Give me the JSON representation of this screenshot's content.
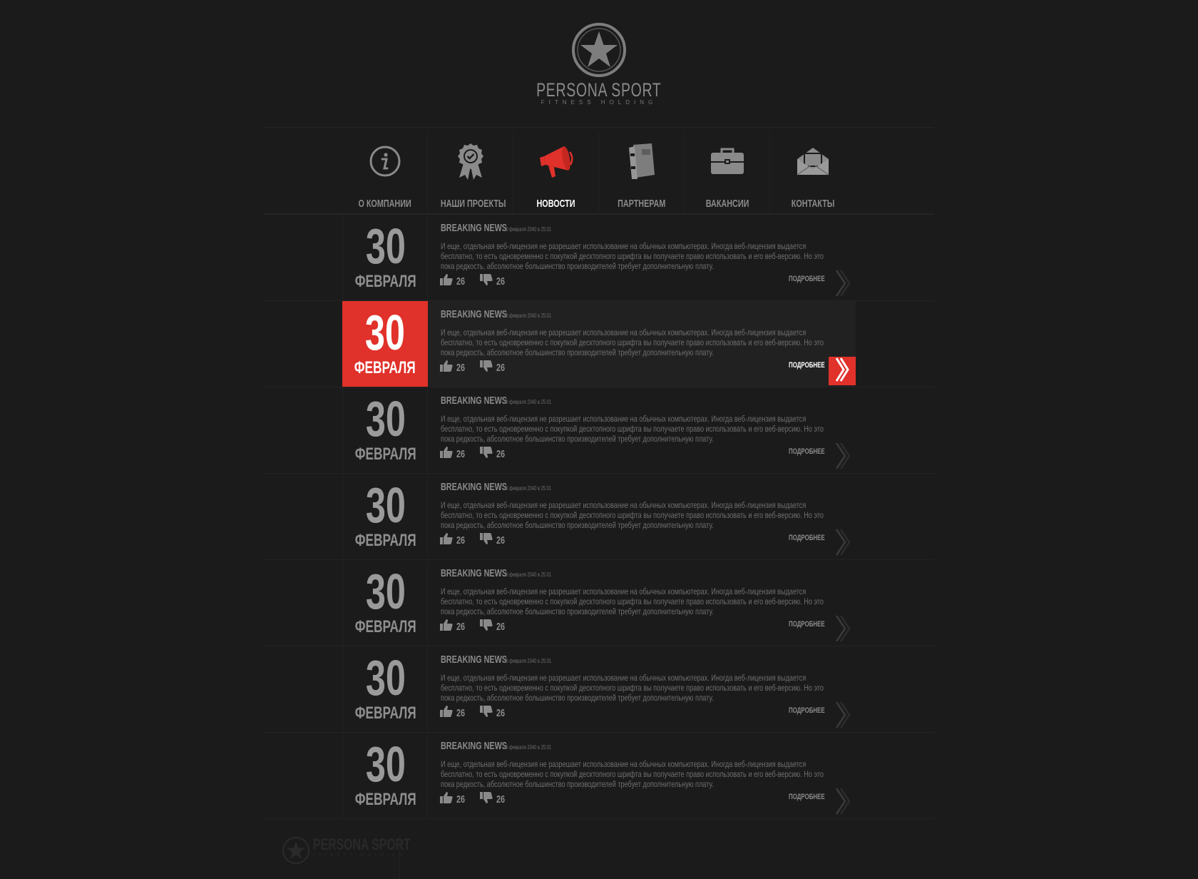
{
  "brand": {
    "name": "PERSONA SPORT",
    "tagline": "FITNESS HOLDING"
  },
  "colors": {
    "accent": "#e0312a",
    "background": "#1b1b1b",
    "text": "#7a7a7a",
    "active_text": "#ffffff"
  },
  "nav": {
    "items": [
      {
        "label": "О КОМПАНИИ",
        "icon": "info-icon",
        "active": false
      },
      {
        "label": "НАШИ ПРОЕКТЫ",
        "icon": "award-ribbon-icon",
        "active": false
      },
      {
        "label": "НОВОСТИ",
        "icon": "megaphone-icon",
        "active": true
      },
      {
        "label": "ПАРТНЕРАМ",
        "icon": "binder-icon",
        "active": false
      },
      {
        "label": "ВАКАНСИИ",
        "icon": "briefcase-icon",
        "active": false
      },
      {
        "label": "КОНТАКТЫ",
        "icon": "envelope-icon",
        "active": false
      }
    ]
  },
  "news": {
    "items": [
      {
        "day": "30",
        "month": "ФЕВРАЛЯ",
        "title": "BREAKING NEWS",
        "time": "30 февраля 2040 в 25:01",
        "text": "И еще, отдельная веб-лицензия не разрешает использование на обычных компьютерах. Иногда веб-лицензия выдается бесплатно, то есть одновременно с покупкой десктопного шрифта вы получаете право использовать и его веб-версию. Но это пока редкость, абсолютное большинство производителей требует дополнительную плату.",
        "likes": "26",
        "dislikes": "26",
        "more": "ПОДРОБНЕЕ",
        "active": false
      },
      {
        "day": "30",
        "month": "ФЕВРАЛЯ",
        "title": "BREAKING NEWS",
        "time": "30 февраля 2040 в 25:01",
        "text": "И еще, отдельная веб-лицензия не разрешает использование на обычных компьютерах. Иногда веб-лицензия выдается бесплатно, то есть одновременно с покупкой десктопного шрифта вы получаете право использовать и его веб-версию. Но это пока редкость, абсолютное большинство производителей требует дополнительную плату.",
        "likes": "26",
        "dislikes": "26",
        "more": "ПОДРОБНЕЕ",
        "active": true
      },
      {
        "day": "30",
        "month": "ФЕВРАЛЯ",
        "title": "BREAKING NEWS",
        "time": "30 февраля 2040 в 25:01",
        "text": "И еще, отдельная веб-лицензия не разрешает использование на обычных компьютерах. Иногда веб-лицензия выдается бесплатно, то есть одновременно с покупкой десктопного шрифта вы получаете право использовать и его веб-версию. Но это пока редкость, абсолютное большинство производителей требует дополнительную плату.",
        "likes": "26",
        "dislikes": "26",
        "more": "ПОДРОБНЕЕ",
        "active": false
      },
      {
        "day": "30",
        "month": "ФЕВРАЛЯ",
        "title": "BREAKING NEWS",
        "time": "30 февраля 2040 в 25:01",
        "text": "И еще, отдельная веб-лицензия не разрешает использование на обычных компьютерах. Иногда веб-лицензия выдается бесплатно, то есть одновременно с покупкой десктопного шрифта вы получаете право использовать и его веб-версию. Но это пока редкость, абсолютное большинство производителей требует дополнительную плату.",
        "likes": "26",
        "dislikes": "26",
        "more": "ПОДРОБНЕЕ",
        "active": false
      },
      {
        "day": "30",
        "month": "ФЕВРАЛЯ",
        "title": "BREAKING NEWS",
        "time": "30 февраля 2040 в 25:01",
        "text": "И еще, отдельная веб-лицензия не разрешает использование на обычных компьютерах. Иногда веб-лицензия выдается бесплатно, то есть одновременно с покупкой десктопного шрифта вы получаете право использовать и его веб-версию. Но это пока редкость, абсолютное большинство производителей требует дополнительную плату.",
        "likes": "26",
        "dislikes": "26",
        "more": "ПОДРОБНЕЕ",
        "active": false
      },
      {
        "day": "30",
        "month": "ФЕВРАЛЯ",
        "title": "BREAKING NEWS",
        "time": "30 февраля 2040 в 25:01",
        "text": "И еще, отдельная веб-лицензия не разрешает использование на обычных компьютерах. Иногда веб-лицензия выдается бесплатно, то есть одновременно с покупкой десктопного шрифта вы получаете право использовать и его веб-версию. Но это пока редкость, абсолютное большинство производителей требует дополнительную плату.",
        "likes": "26",
        "dislikes": "26",
        "more": "ПОДРОБНЕЕ",
        "active": false
      },
      {
        "day": "30",
        "month": "ФЕВРАЛЯ",
        "title": "BREAKING NEWS",
        "time": "30 февраля 2040 в 25:01",
        "text": "И еще, отдельная веб-лицензия не разрешает использование на обычных компьютерах. Иногда веб-лицензия выдается бесплатно, то есть одновременно с покупкой десктопного шрифта вы получаете право использовать и его веб-версию. Но это пока редкость, абсолютное большинство производителей требует дополнительную плату.",
        "likes": "26",
        "dislikes": "26",
        "more": "ПОДРОБНЕЕ",
        "active": false
      }
    ]
  },
  "footer": {
    "brand": "PERSONA SPORT",
    "tagline": "FITNESS HOLDING"
  }
}
